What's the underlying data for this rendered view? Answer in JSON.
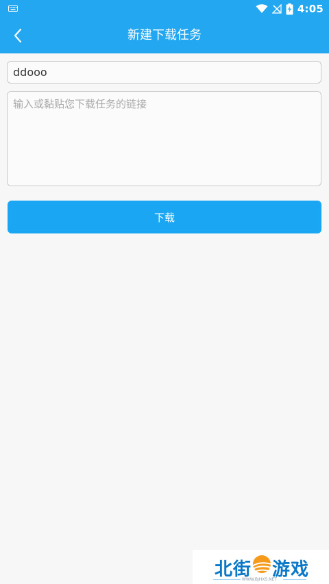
{
  "status_bar": {
    "time": "4:05",
    "icons": [
      "keyboard-icon",
      "wifi-icon",
      "no-signal-icon",
      "battery-charging-icon"
    ]
  },
  "header": {
    "title": "新建下载任务",
    "back_icon": "chevron-left-icon"
  },
  "form": {
    "task_name_value": "ddooo",
    "link_placeholder": "输入或黏贴您下载任务的链接",
    "download_button_label": "下载"
  },
  "watermark": {
    "left_text": "北街",
    "right_text": "游戏",
    "url": "WWW.BJHXS.NET"
  },
  "colors": {
    "accent": "#22a7f0",
    "button": "#1aa6f3",
    "background": "#f7f7f7"
  }
}
